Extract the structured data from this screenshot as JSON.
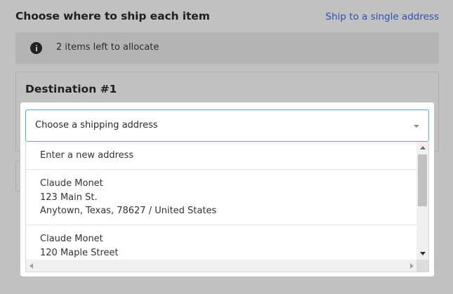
{
  "header": {
    "title": "Choose where to ship each item",
    "single_address_link": "Ship to a single address"
  },
  "info": {
    "icon": "info-icon",
    "message": "2 items left to allocate"
  },
  "destination": {
    "title": "Destination #1"
  },
  "address_select": {
    "selected": "Choose a shipping address",
    "options": [
      {
        "label": "Enter a new address"
      },
      {
        "name": "Claude Monet",
        "street": "123 Main St.",
        "city_line": "Anytown, Texas, 78627 / United States"
      },
      {
        "name": "Claude Monet",
        "street": "120 Maple Street"
      }
    ]
  },
  "colors": {
    "link": "#2f4fb0",
    "focus_border": "#5aa6cf",
    "overlay": "#c1c1c1"
  }
}
